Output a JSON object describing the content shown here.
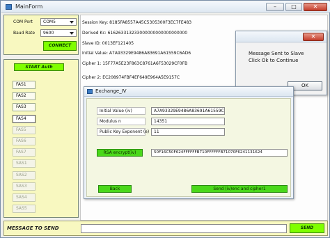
{
  "window": {
    "title": "MainForm",
    "minimize": "–",
    "maximize": "□",
    "close": "✕"
  },
  "settings": {
    "com_port_label": "COM Port",
    "com_port_value": "COM5",
    "baud_rate_label": "Baud Rate",
    "baud_rate_value": "9600",
    "connect_label": "CONNECT"
  },
  "start_button": "START Auth",
  "sensors": [
    "FAS1",
    "FAS2",
    "FAS3",
    "FAS4",
    "FAS5",
    "FAS6",
    "FAS7",
    "SAS1",
    "SAS2",
    "SAS3",
    "SAS4",
    "SAS5"
  ],
  "sensor_states": [
    "enabled",
    "enabled",
    "enabled",
    "active",
    "disabled",
    "disabled",
    "disabled",
    "disabled",
    "disabled",
    "disabled",
    "disabled",
    "disabled"
  ],
  "info": {
    "session_key": "Session Key:  8185FA8557A45C5305300F3EC7FE483",
    "derived_kc": "Derived Kc:  616263313233000000000000000000",
    "slave_id": "Slave ID:  0013EF121405",
    "initial_value": "Initial Value:  A7A93329E9486A83691A61559C6AD6",
    "cipher1": "Cipher 1:  15F77A5E23F863C8761A6F53029CF0FB",
    "cipher2": "Cipher 2:  EC208974FBF4EF649E964A5E9157C"
  },
  "message_dialog": {
    "text_line1": "Message Sent to Slave",
    "text_line2": "Click Ok to Continue",
    "ok_label": "OK",
    "close": "✕"
  },
  "exchange_dialog": {
    "title": "Exchange_IV",
    "iv_label": "Initial Value (iv)",
    "iv_value": "A7A93329E9486A83691A61559C6AD6",
    "modulus_label": "Modulus n",
    "modulus_value": "14351",
    "exponent_label": "Public Key Exponent (e)",
    "exponent_value": "11",
    "rsa_button": "RSA encrypt(iv)",
    "rsa_value": "50F16C50F624FFFFFFB710FFFFFFB71070F6241131624",
    "back_button": "Back",
    "send_button": "Send (iv)enc and cipher1"
  },
  "message_bar": {
    "label": "MESSAGE TO SEND",
    "value": "",
    "send_label": "SEND"
  }
}
